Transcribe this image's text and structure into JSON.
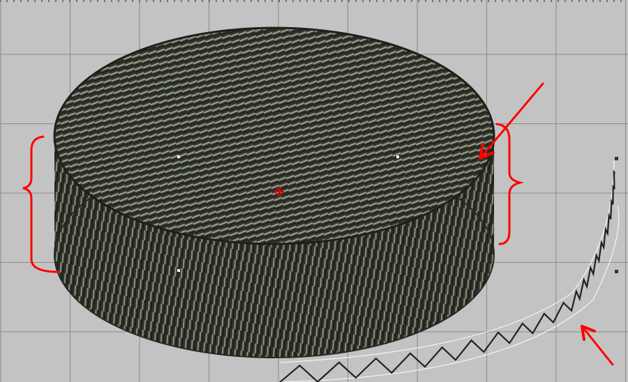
{
  "canvas": {
    "background_color": "#c3c3c3",
    "grid_color": "#8a8a8a",
    "thread_color": "#3c3f38",
    "thread_highlight": "#9aa08e",
    "annotation_color": "#ff0000",
    "selection_outline_color": "#ffffff"
  },
  "design": {
    "object": "hockey-puck-embroidery",
    "annotations": [
      "left-brace",
      "right-brace",
      "top-right-arrow",
      "bottom-right-arrow"
    ],
    "selected_object": "zigzag-satin-stitch-run"
  }
}
